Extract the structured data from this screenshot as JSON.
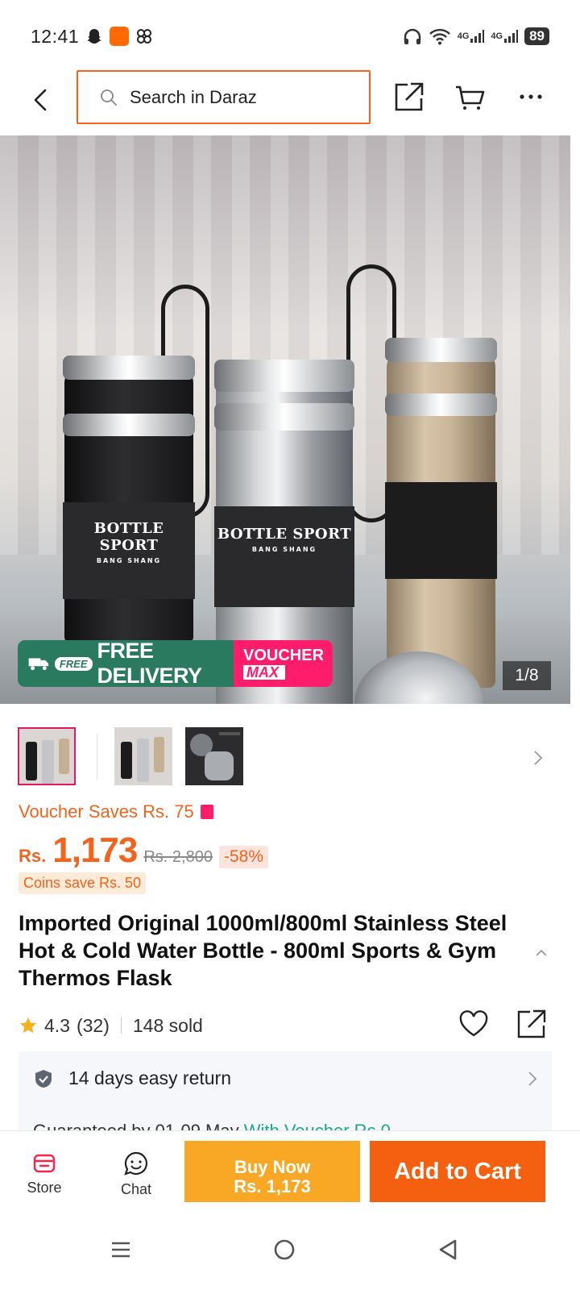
{
  "status_bar": {
    "time": "12:41",
    "network_1": "4G",
    "network_2": "4G",
    "battery": "89"
  },
  "header": {
    "search_placeholder": "Search in Daraz"
  },
  "hero": {
    "free_pill": "FREE",
    "free_delivery": "FREE DELIVERY",
    "voucher_top": "VOUCHER",
    "voucher_bottom": "MAX",
    "counter": "1/8",
    "bottle_brand": "BOTTLE SPORT",
    "bottle_sub": "BANG SHANG"
  },
  "price": {
    "voucher_saves": "Voucher Saves Rs. 75",
    "currency": "Rs.",
    "current": "1,173",
    "original": "Rs. 2,800",
    "discount": "-58%",
    "coins": "Coins save Rs. 50"
  },
  "product": {
    "title": "Imported Original 1000ml/800ml Stainless Steel Hot & Cold Water Bottle - 800ml Sports & Gym Thermos Flask",
    "rating": "4.3",
    "reviews": "(32)",
    "sold": "148 sold"
  },
  "services": {
    "return_policy": "14 days easy return",
    "partial_prefix": "Guaranteed by 01-09 May",
    "partial_green": "With Voucher Rs.0"
  },
  "action_bar": {
    "store": "Store",
    "chat": "Chat",
    "buy_now_label": "Buy Now",
    "buy_now_price": "Rs. 1,173",
    "add_to_cart": "Add to Cart"
  },
  "colors": {
    "accent": "#f55f10",
    "buy_now": "#f9a825",
    "voucher_pink": "#ff1c6a",
    "free_delivery_green": "#2a7a5f"
  }
}
